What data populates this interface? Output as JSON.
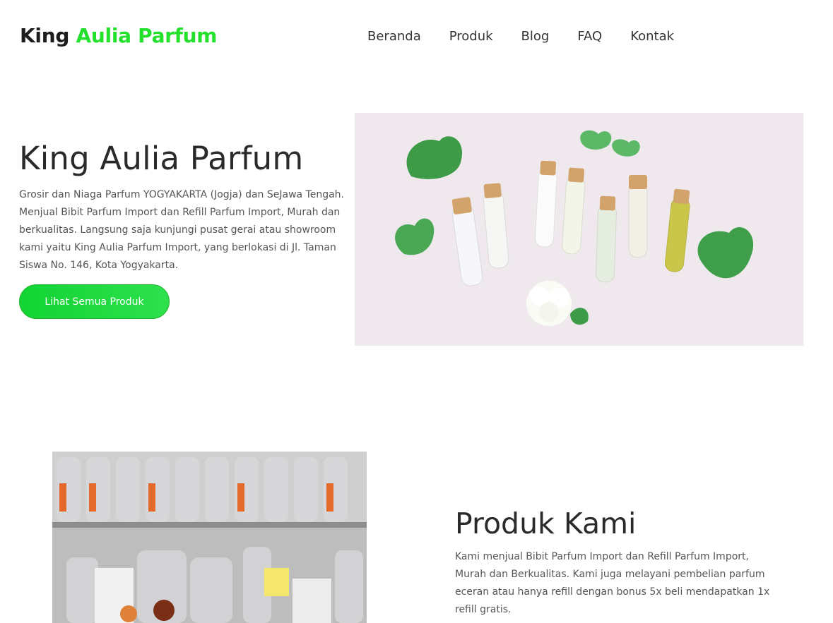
{
  "header": {
    "logo_part1": "King",
    "logo_part2": "Aulia Parfum",
    "nav": [
      "Beranda",
      "Produk",
      "Blog",
      "FAQ",
      "Kontak"
    ]
  },
  "hero": {
    "title": "King Aulia Parfum",
    "description": "Grosir dan Niaga Parfum YOGYAKARTA (Jogja) dan SeJawa Tengah. Menjual Bibit Parfum Import dan Refill Parfum Import, Murah dan berkualitas. Langsung saja kunjungi pusat gerai atau showroom kami yaitu King Aulia Parfum Import, yang berlokasi di Jl. Taman Siswa No. 146, Kota Yogyakarta.",
    "button_label": "Lihat Semua Produk"
  },
  "produk": {
    "title": "Produk Kami",
    "description": "Kami menjual Bibit Parfum Import dan Refill Parfum Import, Murah dan Berkualitas. Kami juga melayani pembelian parfum eceran atau hanya refill dengan bonus 5x beli mendapatkan 1x refill gratis."
  },
  "colors": {
    "brand_green": "#22e02c",
    "button_green": "#12d434"
  }
}
